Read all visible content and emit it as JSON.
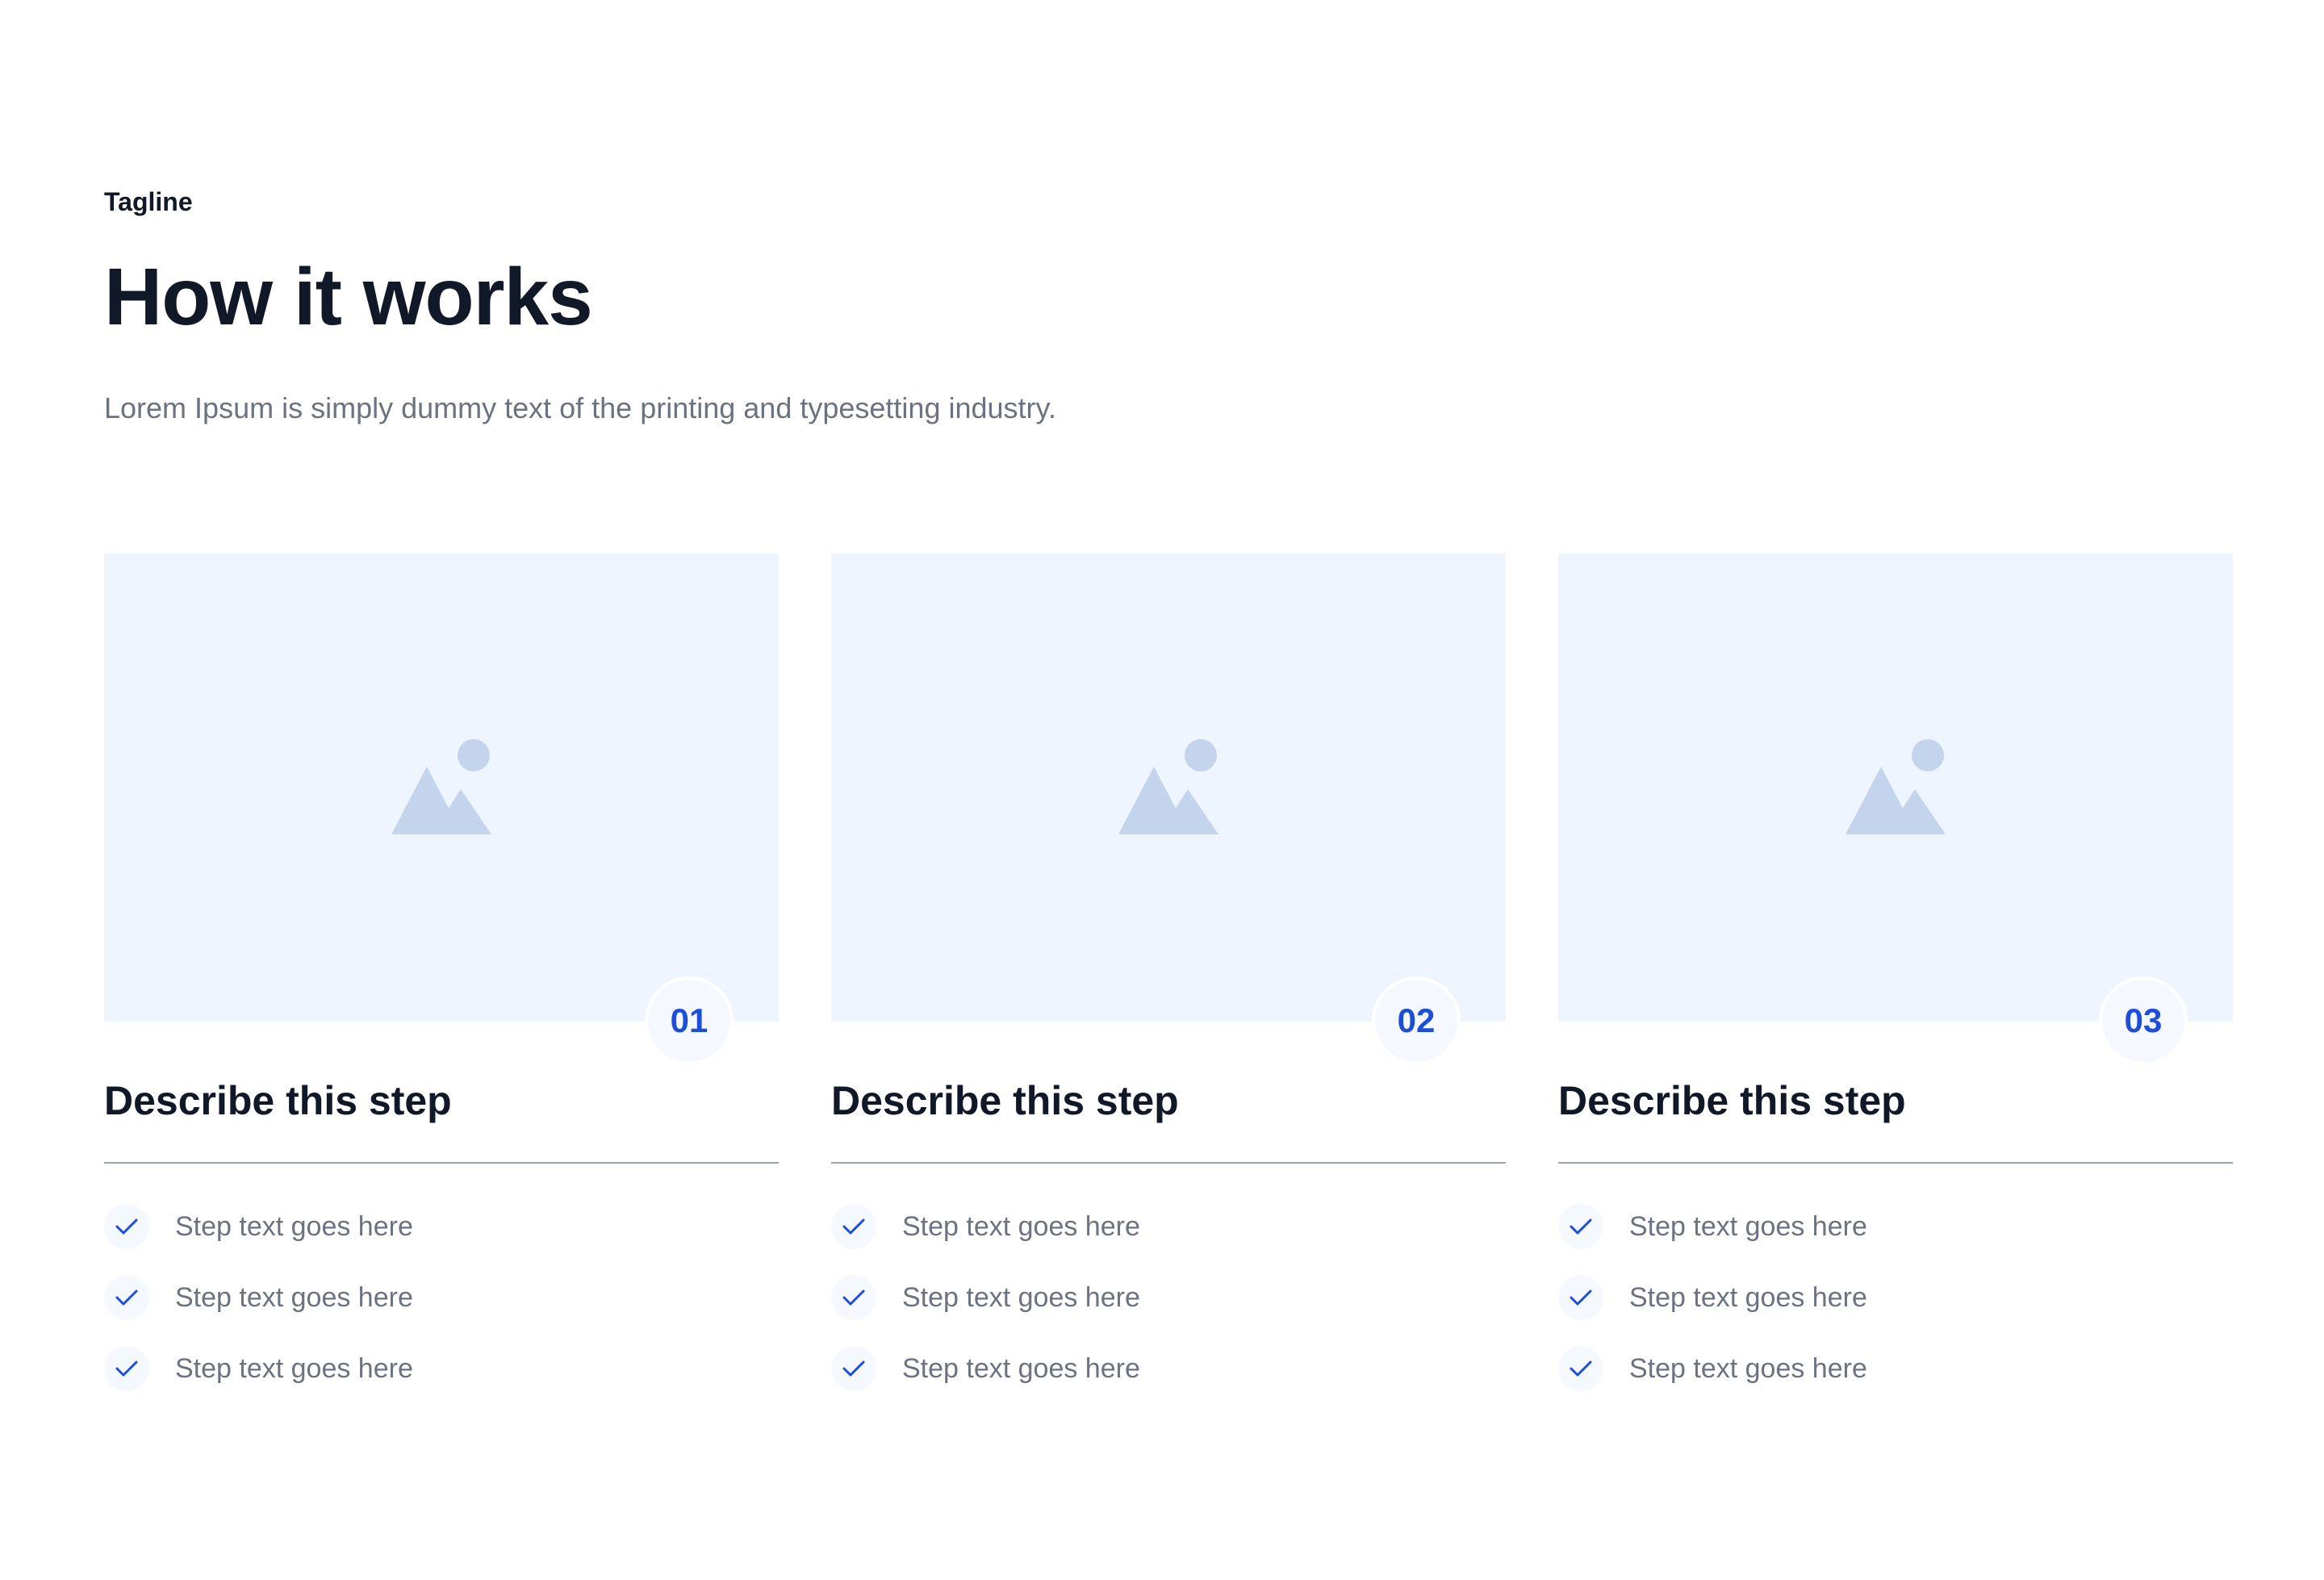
{
  "header": {
    "tagline": "Tagline",
    "title": "How it works",
    "subtitle": "Lorem Ipsum is simply dummy text of the printing and typesetting industry."
  },
  "colors": {
    "accent": "#1d4ed8",
    "image_placeholder_bg": "#eef5fe",
    "image_placeholder_icon": "#c3d4ec",
    "heading": "#111827",
    "muted_text": "#6b7280"
  },
  "steps": [
    {
      "number": "01",
      "title": "Describe this step",
      "image_icon": "image-placeholder-icon",
      "items": [
        "Step text goes here",
        "Step text goes here",
        "Step text goes here"
      ]
    },
    {
      "number": "02",
      "title": "Describe this step",
      "image_icon": "image-placeholder-icon",
      "items": [
        "Step text goes here",
        "Step text goes here",
        "Step text goes here"
      ]
    },
    {
      "number": "03",
      "title": "Describe this step",
      "image_icon": "image-placeholder-icon",
      "items": [
        "Step text goes here",
        "Step text goes here",
        "Step text goes here"
      ]
    }
  ]
}
